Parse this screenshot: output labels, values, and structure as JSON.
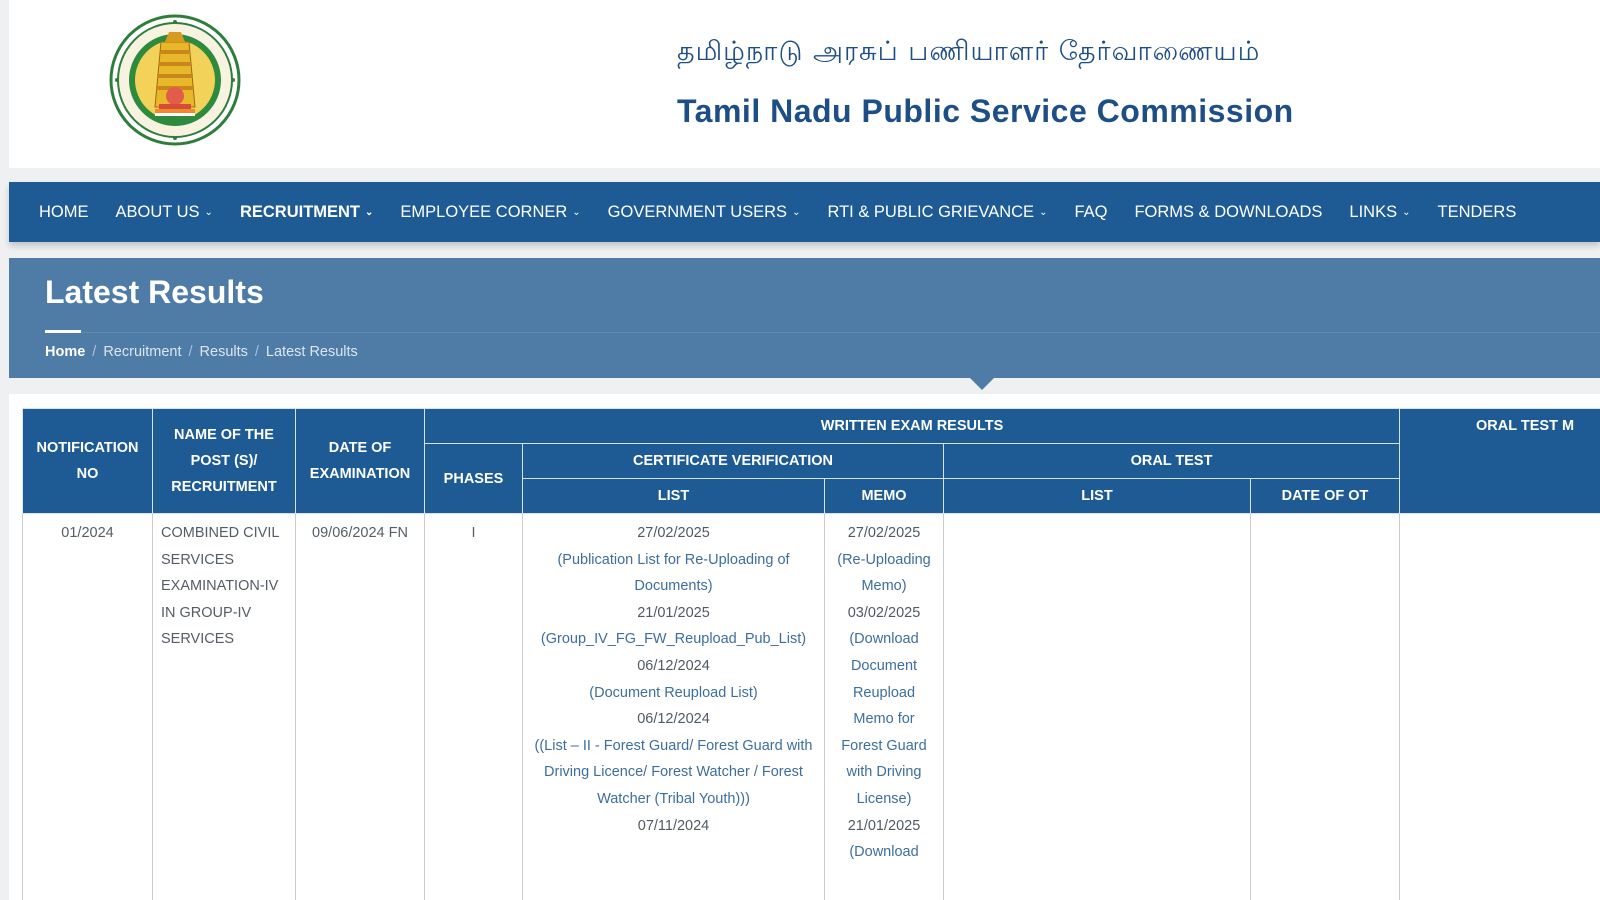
{
  "header": {
    "tamil_title": "தமிழ்நாடு அரசுப் பணியாளர் தேர்வாணையம்",
    "english_title": "Tamil Nadu Public Service Commission",
    "emblem_icon": "tamil-nadu-emblem-icon"
  },
  "nav": {
    "items": [
      {
        "label": "HOME"
      },
      {
        "label": "ABOUT US",
        "dropdown": true
      },
      {
        "label": "RECRUITMENT",
        "dropdown": true,
        "active": true
      },
      {
        "label": "EMPLOYEE CORNER",
        "dropdown": true
      },
      {
        "label": "GOVERNMENT USERS",
        "dropdown": true
      },
      {
        "label": "RTI & PUBLIC GRIEVANCE",
        "dropdown": true
      },
      {
        "label": "FAQ"
      },
      {
        "label": "FORMS & DOWNLOADS"
      },
      {
        "label": "LINKS",
        "dropdown": true
      },
      {
        "label": "TENDERS"
      }
    ]
  },
  "page": {
    "title": "Latest Results",
    "breadcrumb": [
      "Home",
      "Recruitment",
      "Results",
      "Latest Results"
    ]
  },
  "table": {
    "headers": {
      "notification_no": "NOTIFICATION NO",
      "post_name": "NAME OF THE POST (S)/ RECRUITMENT",
      "date_of_exam": "DATE OF EXAMINATION",
      "written_exam_results": "WRITTEN EXAM RESULTS",
      "oral_test_memo": "ORAL TEST M",
      "phases": "PHASES",
      "certificate_verification": "CERTIFICATE VERIFICATION",
      "oral_test": "ORAL TEST",
      "cv_list": "LIST",
      "cv_memo": "MEMO",
      "ot_list": "LIST",
      "date_of_ot": "DATE OF OT"
    },
    "rows": [
      {
        "notification_no": "01/2024",
        "post_name": "COMBINED CIVIL SERVICES EXAMINATION-IV IN GROUP-IV SERVICES",
        "date_of_exam": "09/06/2024 FN",
        "phase": "I",
        "cv_list": [
          {
            "text": "27/02/2025",
            "kind": "date"
          },
          {
            "text": "(Publication List for Re-Uploading of Documents)",
            "kind": "link"
          },
          {
            "text": "21/01/2025",
            "kind": "date"
          },
          {
            "text": "(Group_IV_FG_FW_Reupload_Pub_List)",
            "kind": "link"
          },
          {
            "text": "06/12/2024",
            "kind": "date"
          },
          {
            "text": "(Document Reupload List)",
            "kind": "link"
          },
          {
            "text": "06/12/2024",
            "kind": "date"
          },
          {
            "text": "((List – II - Forest Guard/ Forest Guard with Driving Licence/ Forest Watcher / Forest Watcher (Tribal Youth)))",
            "kind": "link"
          },
          {
            "text": "07/11/2024",
            "kind": "date"
          }
        ],
        "cv_memo": [
          {
            "text": "27/02/2025",
            "kind": "date"
          },
          {
            "text": "(Re-Uploading Memo)",
            "kind": "link"
          },
          {
            "text": "03/02/2025",
            "kind": "date"
          },
          {
            "text": "(Download Document Reupload Memo for Forest Guard with Driving License)",
            "kind": "link"
          },
          {
            "text": "21/01/2025",
            "kind": "date"
          },
          {
            "text": "(Download",
            "kind": "link"
          }
        ],
        "ot_list": "",
        "date_of_ot": "",
        "oral_test_memo": ""
      }
    ]
  },
  "colors": {
    "nav_bg": "#1e5b94",
    "banner_bg": "#4e7ca6",
    "title_text": "#1d4f86",
    "link_text": "#3c6f9e"
  }
}
